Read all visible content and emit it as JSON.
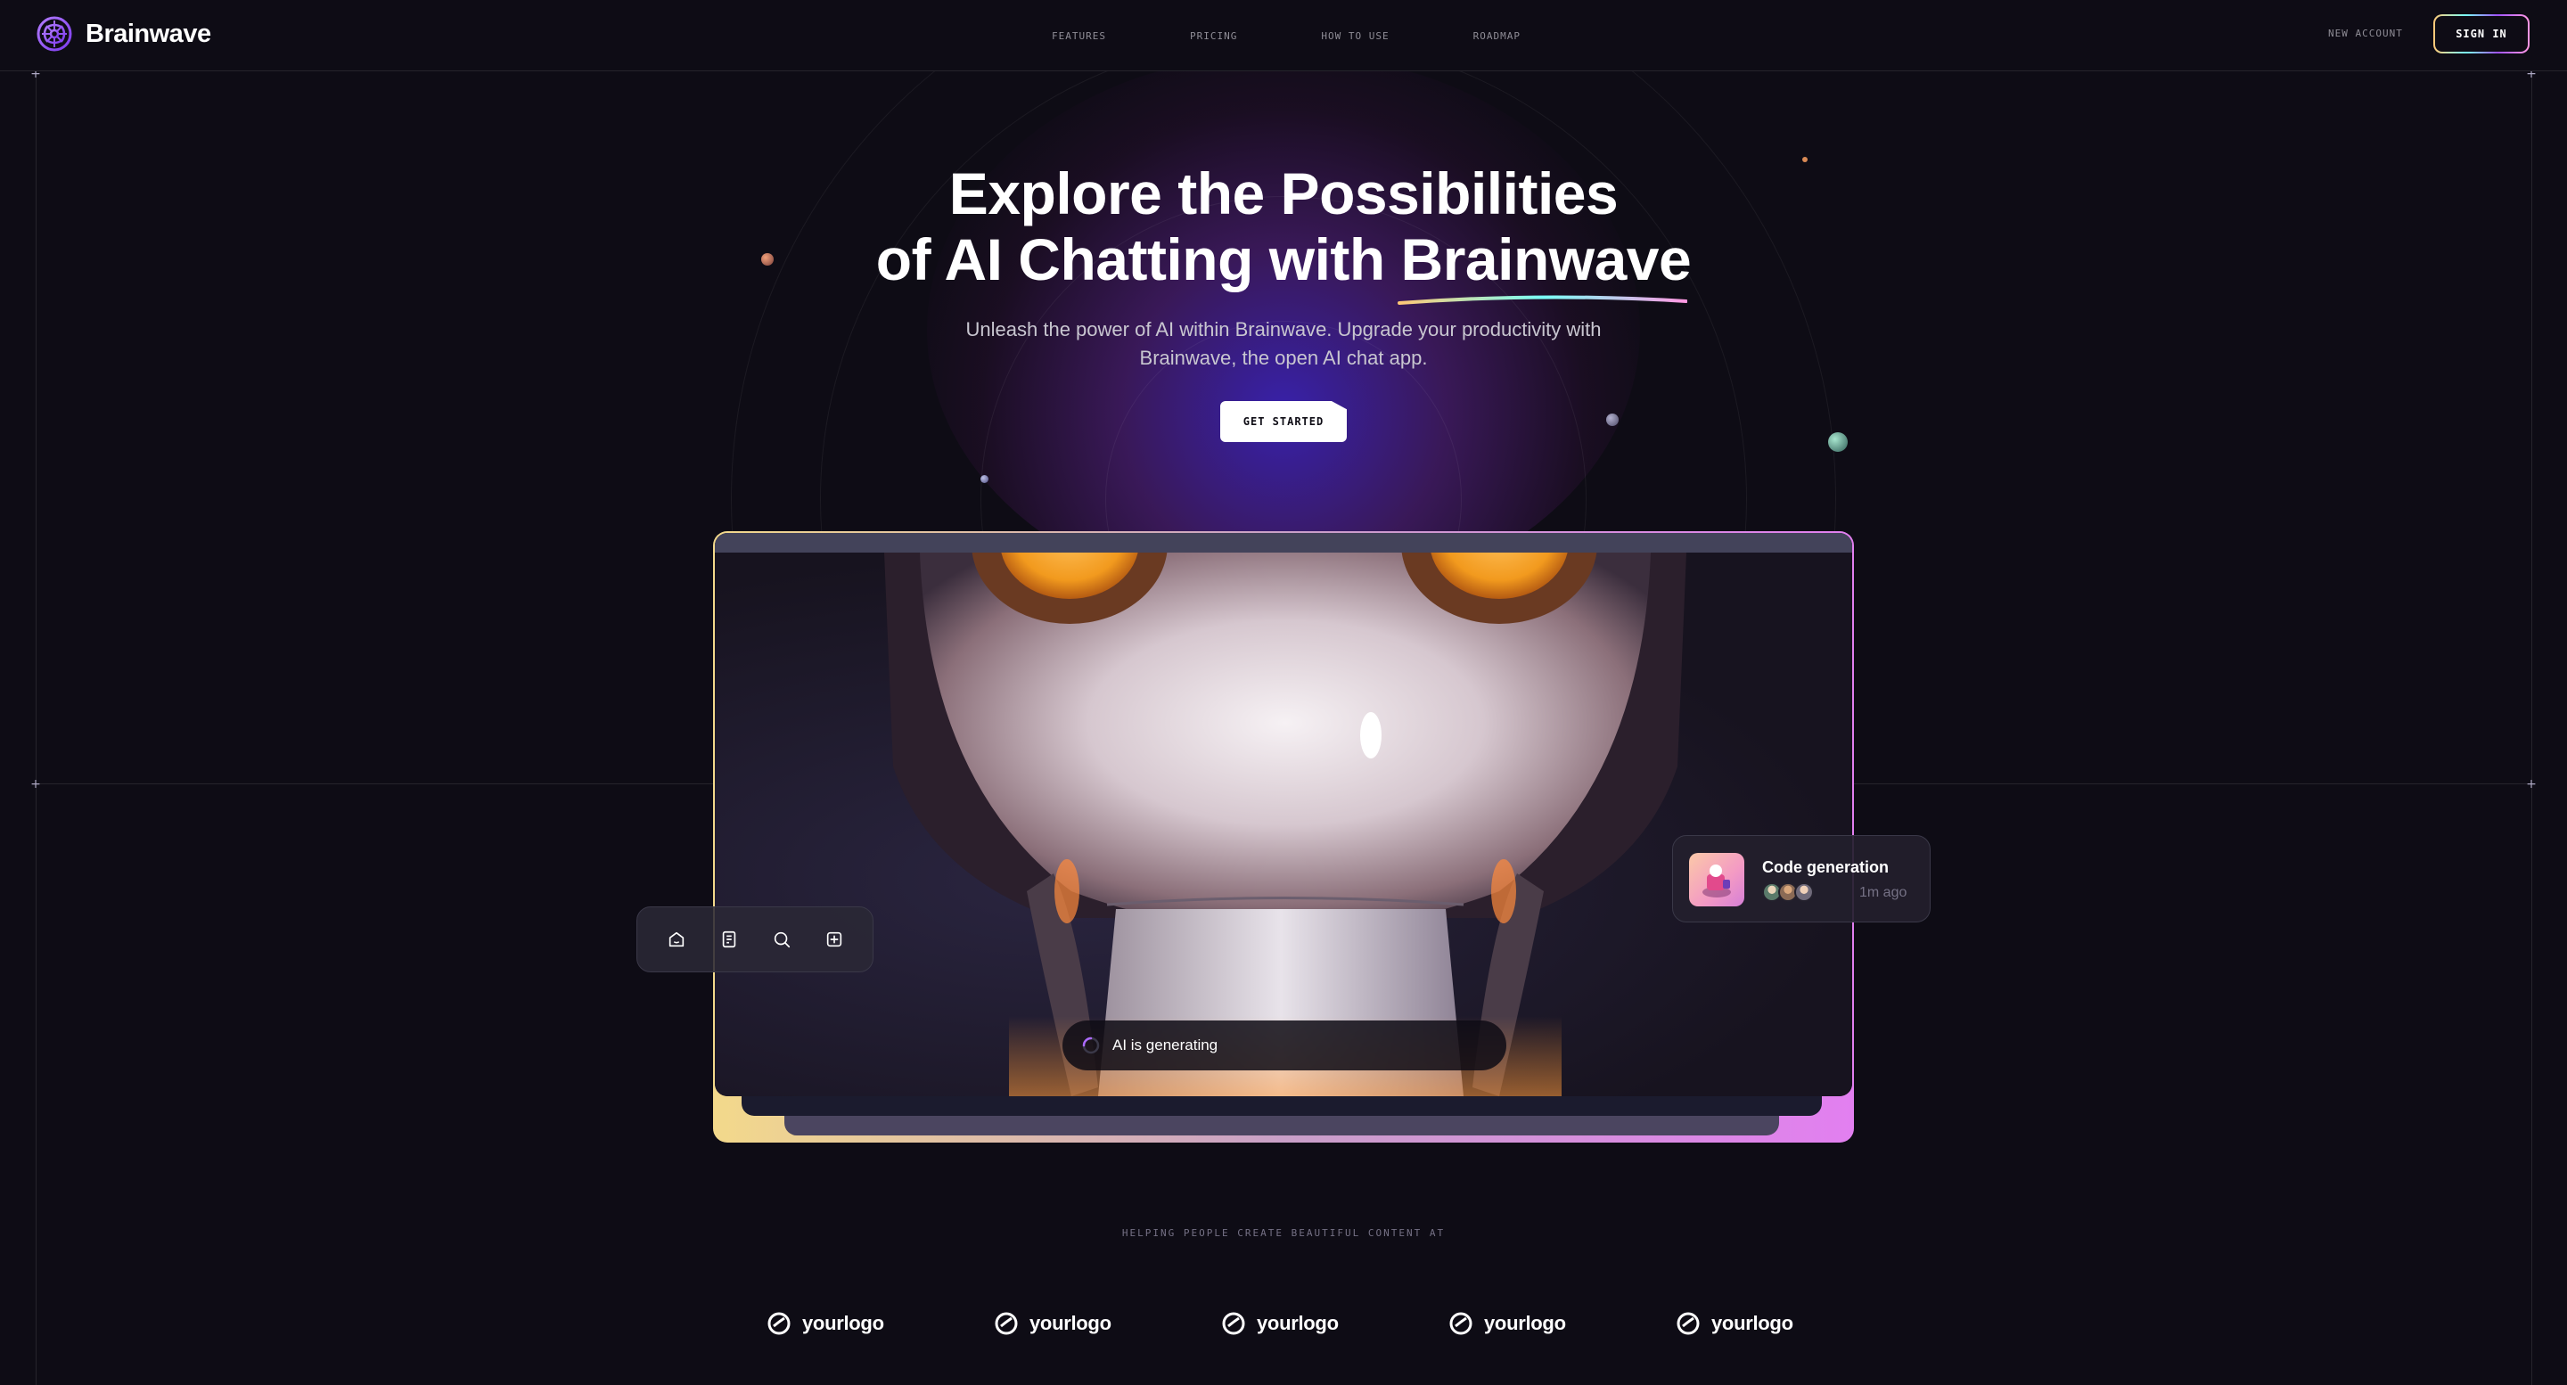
{
  "brand": {
    "name": "Brainwave",
    "logo_icon": "brain-icon"
  },
  "nav": {
    "items": [
      {
        "label": "FEATURES"
      },
      {
        "label": "PRICING"
      },
      {
        "label": "HOW TO USE"
      },
      {
        "label": "ROADMAP"
      }
    ],
    "new_account": "NEW ACCOUNT",
    "sign_in": "SIGN IN"
  },
  "hero": {
    "title_line1": "Explore the Possibilities",
    "title_line2_prefix": "of AI Chatting with ",
    "title_highlight": "Brainwave",
    "subtitle": "Unleash the power of AI within Brainwave. Upgrade your productivity with Brainwave, the open AI chat app.",
    "cta": "GET STARTED"
  },
  "preview": {
    "toolbar_icons": [
      "home-icon",
      "document-icon",
      "search-icon",
      "add-icon"
    ],
    "notification": {
      "title": "Code generation",
      "time": "1m ago"
    },
    "status": "AI is generating"
  },
  "companies": {
    "heading": "HELPING PEOPLE CREATE BEAUTIFUL CONTENT AT",
    "logos": [
      "yourlogo",
      "yourlogo",
      "yourlogo",
      "yourlogo",
      "yourlogo"
    ]
  },
  "colors": {
    "background": "#0e0c15",
    "stroke": "#26242c",
    "accent_yellow": "#ffc876",
    "accent_teal": "#79fff7",
    "accent_purple": "#9f53ff",
    "accent_pink": "#ff98e2",
    "muted_text": "#757185"
  }
}
